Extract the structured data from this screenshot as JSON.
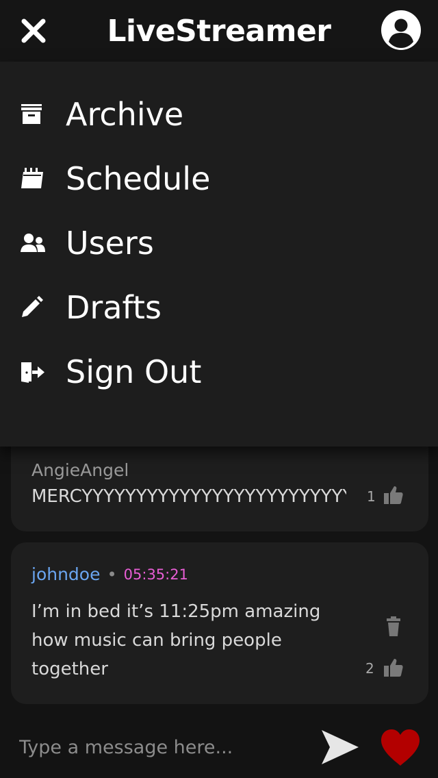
{
  "header": {
    "title": "LiveStreamer",
    "close_icon": "close-icon",
    "profile_icon": "user-circle-icon"
  },
  "menu": {
    "items": [
      {
        "label": "Archive",
        "icon": "archive-box-icon"
      },
      {
        "label": "Schedule",
        "icon": "calendar-icon"
      },
      {
        "label": "Users",
        "icon": "users-icon"
      },
      {
        "label": "Drafts",
        "icon": "pencil-icon"
      },
      {
        "label": "Sign Out",
        "icon": "sign-out-icon"
      }
    ]
  },
  "chat": {
    "messages": [
      {
        "username": "AngieAngel",
        "text": "MERCYYYYYYYYYYYYYYYYYYYYYYYYYY",
        "likes": "1"
      },
      {
        "username": "johndoe",
        "timestamp": "05:35:21",
        "text_lines": [
          "I’m in bed it’s 11:25pm amazing",
          "how music can bring people",
          "together"
        ],
        "likes": "2"
      }
    ]
  },
  "input": {
    "placeholder": "Type a message here..."
  },
  "colors": {
    "accent_username": "#6aa5f0",
    "timestamp": "#e85ed5",
    "heart": "#b30000",
    "menu_bg": "#1d1d1d",
    "app_bg": "#131313"
  }
}
